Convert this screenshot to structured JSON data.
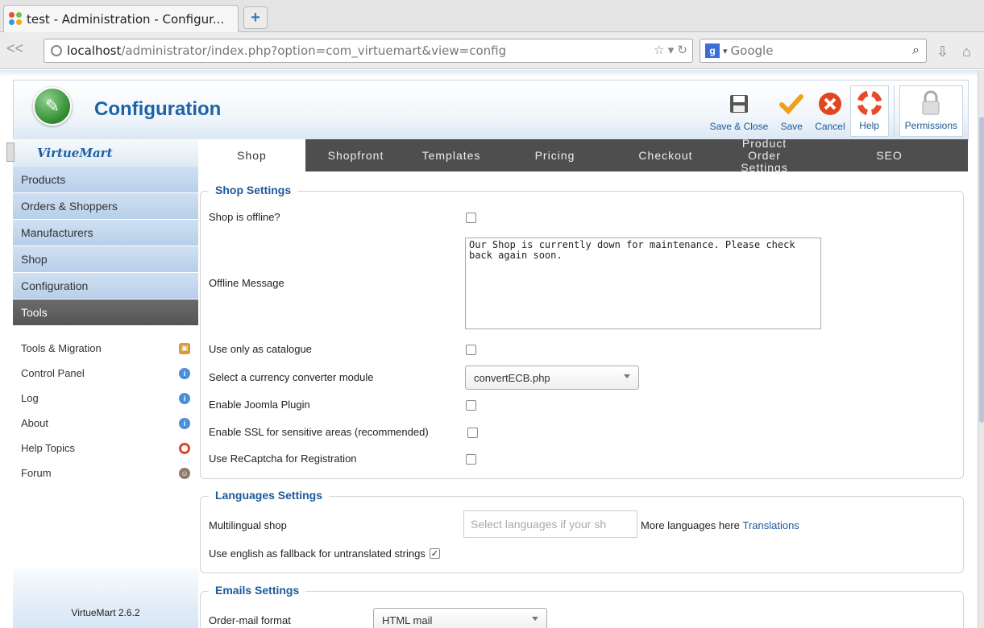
{
  "browser": {
    "tab_title": "test - Administration - Configur...",
    "url_host": "localhost",
    "url_path": "/administrator/index.php?option=com_virtuemart&view=config",
    "search_engine": "Google"
  },
  "header": {
    "title": "Configuration",
    "toolbar": {
      "save_close": "Save & Close",
      "save": "Save",
      "cancel": "Cancel",
      "help": "Help",
      "permissions": "Permissions"
    }
  },
  "sidebar": {
    "logo": "VirtueMart",
    "menu": [
      "Products",
      "Orders & Shoppers",
      "Manufacturers",
      "Shop",
      "Configuration",
      "Tools"
    ],
    "active_index": 5,
    "submenu": [
      {
        "label": "Tools & Migration",
        "icon": "box-icon",
        "color": "#d49a3a"
      },
      {
        "label": "Control Panel",
        "icon": "info-icon",
        "color": "#4a8fd9"
      },
      {
        "label": "Log",
        "icon": "info-icon",
        "color": "#4a8fd9"
      },
      {
        "label": "About",
        "icon": "info-icon",
        "color": "#4a8fd9"
      },
      {
        "label": "Help Topics",
        "icon": "lifebuoy-icon",
        "color": "#e0462e"
      },
      {
        "label": "Forum",
        "icon": "users-icon",
        "color": "#8a7d6a"
      }
    ],
    "version": "VirtueMart 2.6.2"
  },
  "tabs": [
    "Shop",
    "Shopfront",
    "Templates",
    "Pricing",
    "Checkout",
    "Product Order Settings",
    "SEO"
  ],
  "shop_settings": {
    "legend": "Shop Settings",
    "offline_label": "Shop is offline?",
    "offline_message_label": "Offline Message",
    "offline_message_value": "Our Shop is currently down for maintenance. Please check back again soon.",
    "catalogue_label": "Use only as catalogue",
    "currency_label": "Select a currency converter module",
    "currency_value": "convertECB.php",
    "joomla_plugin_label": "Enable Joomla Plugin",
    "ssl_label": "Enable SSL for sensitive areas (recommended)",
    "recaptcha_label": "Use ReCaptcha for Registration"
  },
  "languages_settings": {
    "legend": "Languages Settings",
    "multilingual_label": "Multilingual shop",
    "multilingual_placeholder": "Select languages if your sh",
    "more_languages": "More languages here",
    "translations_link": "Translations",
    "fallback_label": "Use english as fallback for untranslated strings",
    "fallback_checked": "✓"
  },
  "emails_settings": {
    "legend": "Emails Settings",
    "order_mail_label": "Order-mail format",
    "order_mail_value": "HTML mail"
  }
}
